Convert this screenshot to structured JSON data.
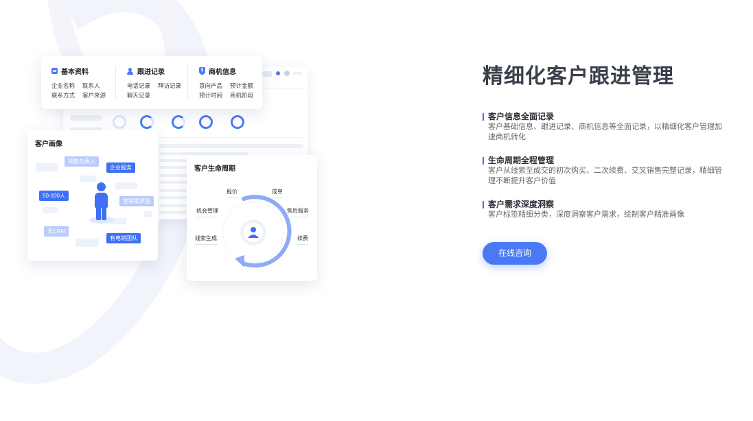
{
  "info_card": {
    "columns": [
      {
        "title": "基本资料",
        "icon": "document-icon",
        "items": [
          "企业名称",
          "联系人",
          "联系方式",
          "客户来源"
        ]
      },
      {
        "title": "跟进记录",
        "icon": "user-icon",
        "items": [
          "电话记录",
          "拜访记录",
          "聊天记录"
        ]
      },
      {
        "title": "商机信息",
        "icon": "shield-icon",
        "items": [
          "意向产品",
          "预计金额",
          "预计时间",
          "商机阶段"
        ]
      }
    ]
  },
  "portrait_card": {
    "title": "客户画像",
    "tags": [
      "销售负责人",
      "企业服务",
      "50-100人",
      "营销需求强",
      "无CRM",
      "有电销团队"
    ]
  },
  "cycle_card": {
    "title": "客户生命周期",
    "stages": [
      "报价",
      "成单",
      "机会管理",
      "售后服务",
      "线索生成",
      "续费"
    ]
  },
  "main": {
    "title": "精细化客户跟进管理",
    "features": [
      {
        "heading": "客户信息全面记录",
        "desc": "客户基础信息、跟进记录、商机信息等全面记录，以精细化客户管理加速商机转化"
      },
      {
        "heading": "生命周期全程管理",
        "desc": "客户从线索至成交的初次购买、二次续费、交叉销售完整记录，精细管理不断提升客户价值"
      },
      {
        "heading": "客户需求深度洞察",
        "desc": "客户标签精细分类，深度洞察客户需求，绘制客户精准画像"
      }
    ],
    "cta_label": "在线咨询"
  },
  "colors": {
    "accent": "#4a79f6",
    "tag_dark": "#3e6ff5",
    "tag_light": "#b9ccfb"
  }
}
